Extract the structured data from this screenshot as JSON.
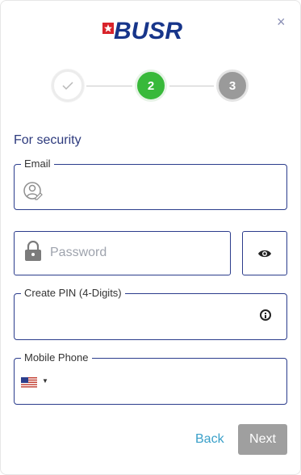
{
  "brand": {
    "logo_text": "BUSR"
  },
  "close_label": "×",
  "steps": [
    {
      "label": "✓",
      "state": "done"
    },
    {
      "label": "2",
      "state": "active"
    },
    {
      "label": "3",
      "state": "upcoming"
    }
  ],
  "form": {
    "section_title": "For security",
    "email": {
      "label": "Email",
      "value": ""
    },
    "password": {
      "placeholder": "Password",
      "value": ""
    },
    "pin": {
      "label": "Create PIN (4-Digits)",
      "value": ""
    },
    "phone": {
      "label": "Mobile Phone",
      "country": "US",
      "value": ""
    }
  },
  "buttons": {
    "back": "Back",
    "next": "Next"
  },
  "colors": {
    "primary": "#1c2e7d",
    "success": "#38b93a",
    "link": "#3aa0c9",
    "disabled": "#9f9f9f"
  }
}
